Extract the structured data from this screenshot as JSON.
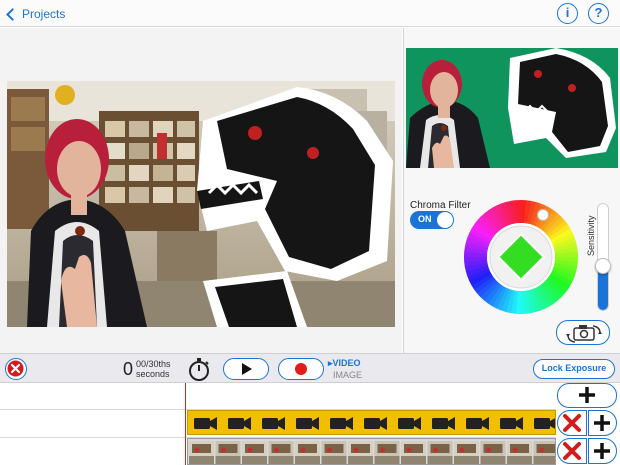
{
  "nav": {
    "back_label": "Projects",
    "info_label": "i",
    "help_label": "?"
  },
  "chroma": {
    "filter_label": "Chroma Filter",
    "toggle_label": "ON",
    "toggle_on": true,
    "sensitivity_label": "Sensitivity",
    "sensitivity_level": 0.42,
    "key_color": "#33dd22"
  },
  "controls": {
    "time_value": "0",
    "time_fraction": "00/30ths",
    "time_unit": "seconds",
    "mode_video_label": "VIDEO",
    "mode_image_label": "IMAGE",
    "lock_exposure_label": "Lock Exposure"
  },
  "colors": {
    "accent": "#1a73d9",
    "record": "#e21b1b",
    "delete": "#d21c1c",
    "video_track": "#f2bf00",
    "playhead": "#e02020"
  },
  "icons": {
    "back": "chevron-left-icon",
    "info": "info-icon",
    "help": "help-icon",
    "delete": "close-icon",
    "timer": "timer-icon",
    "play": "play-icon",
    "record": "record-icon",
    "camera_switch": "camera-switch-icon",
    "add": "plus-icon",
    "video_clip": "video-camera-icon"
  }
}
